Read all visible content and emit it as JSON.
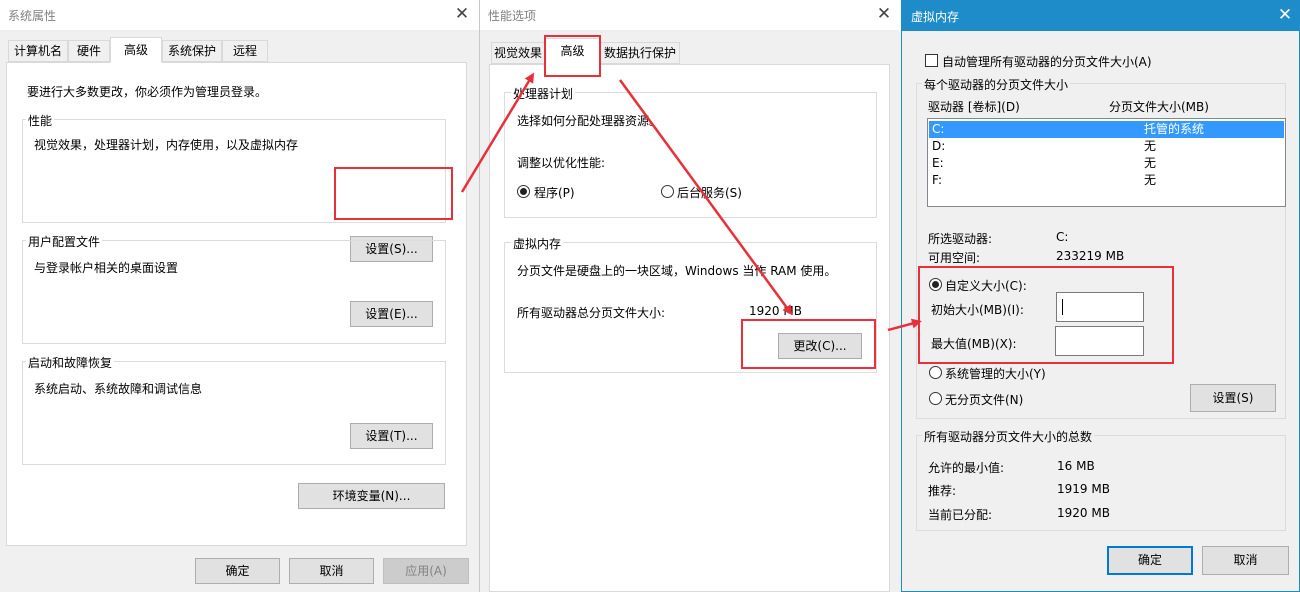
{
  "sys": {
    "title": "系统属性",
    "tabs": [
      "计算机名",
      "硬件",
      "高级",
      "系统保护",
      "远程"
    ],
    "admin_note": "要进行大多数更改，你必须作为管理员登录。",
    "perf_title": "性能",
    "perf_desc": "视觉效果，处理器计划，内存使用，以及虚拟内存",
    "perf_btn": "设置(S)...",
    "profile_title": "用户配置文件",
    "profile_desc": "与登录帐户相关的桌面设置",
    "profile_btn": "设置(E)...",
    "startup_title": "启动和故障恢复",
    "startup_desc": "系统启动、系统故障和调试信息",
    "startup_btn": "设置(T)...",
    "env_btn": "环境变量(N)...",
    "ok": "确定",
    "cancel": "取消",
    "apply": "应用(A)"
  },
  "perf": {
    "title": "性能选项",
    "tabs": [
      "视觉效果",
      "高级",
      "数据执行保护"
    ],
    "sched_title": "处理器计划",
    "sched_desc": "选择如何分配处理器资源。",
    "optimize_label": "调整以优化性能:",
    "opt_programs": "程序(P)",
    "opt_services": "后台服务(S)",
    "vm_title": "虚拟内存",
    "vm_desc": "分页文件是硬盘上的一块区域，Windows 当作 RAM 使用。",
    "vm_total_label": "所有驱动器总分页文件大小:",
    "vm_total_value": "1920 MB",
    "change_btn": "更改(C)..."
  },
  "vm": {
    "title": "虚拟内存",
    "auto_manage": "自动管理所有驱动器的分页文件大小(A)",
    "per_drive_title": "每个驱动器的分页文件大小",
    "col_drive": "驱动器 [卷标](D)",
    "col_size": "分页文件大小(MB)",
    "drives": [
      {
        "drive": "C:",
        "size": "托管的系统"
      },
      {
        "drive": "D:",
        "size": "无"
      },
      {
        "drive": "E:",
        "size": "无"
      },
      {
        "drive": "F:",
        "size": "无"
      }
    ],
    "selected_drive_label": "所选驱动器:",
    "selected_drive_value": "C:",
    "free_space_label": "可用空间:",
    "free_space_value": "233219 MB",
    "custom_size": "自定义大小(C):",
    "initial_label": "初始大小(MB)(I):",
    "initial_value": "",
    "max_label": "最大值(MB)(X):",
    "max_value": "",
    "system_managed": "系统管理的大小(Y)",
    "no_paging": "无分页文件(N)",
    "set_btn": "设置(S)",
    "totals_title": "所有驱动器分页文件大小的总数",
    "min_allowed_label": "允许的最小值:",
    "min_allowed_value": "16 MB",
    "recommended_label": "推荐:",
    "recommended_value": "1919 MB",
    "current_label": "当前已分配:",
    "current_value": "1920 MB",
    "ok": "确定",
    "cancel": "取消"
  },
  "colors": {
    "highlight_red": "#e8303a",
    "active_title_blue": "#1e8cc9",
    "selection_blue": "#3399ff"
  }
}
